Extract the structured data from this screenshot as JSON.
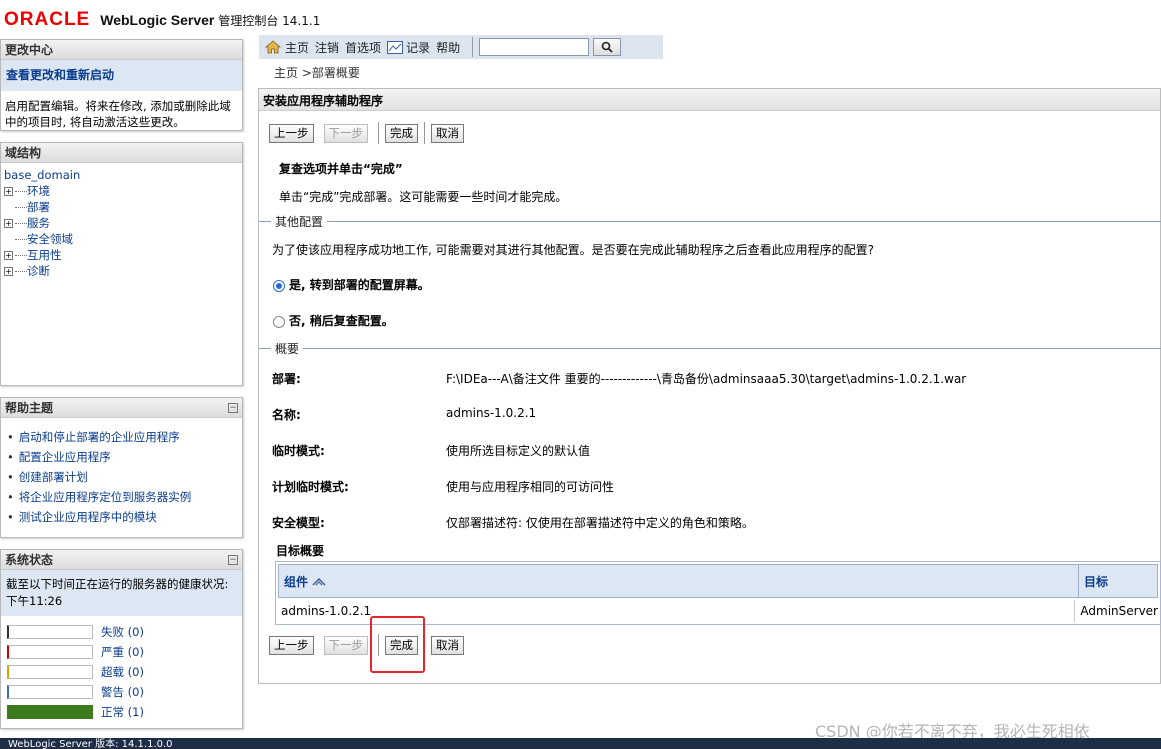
{
  "header": {
    "brand": "ORACLE",
    "product": "WebLogic Server",
    "subtitle": "管理控制台 14.1.1"
  },
  "change_center": {
    "title": "更改中心",
    "link": "查看更改和重新启动",
    "text": "启用配置编辑。将来在修改, 添加或删除此域中的项目时, 将自动激活这些更改。"
  },
  "domain_structure": {
    "title": "域结构",
    "root": "base_domain",
    "nodes": [
      {
        "label": "环境",
        "expandable": true
      },
      {
        "label": "部署",
        "expandable": false
      },
      {
        "label": "服务",
        "expandable": true
      },
      {
        "label": "安全领域",
        "expandable": false
      },
      {
        "label": "互用性",
        "expandable": true
      },
      {
        "label": "诊断",
        "expandable": true
      }
    ]
  },
  "help": {
    "title": "帮助主题",
    "items": [
      "启动和停止部署的企业应用程序",
      "配置企业应用程序",
      "创建部署计划",
      "将企业应用程序定位到服务器实例",
      "测试企业应用程序中的模块"
    ]
  },
  "system_status": {
    "title": "系统状态",
    "text": "截至以下时间正在运行的服务器的健康状况: 下午11:26",
    "rows": [
      {
        "label": "失败 (0)",
        "color": "#cc0000",
        "fill": 0
      },
      {
        "label": "严重 (0)",
        "color": "#cc0000",
        "fill": 0
      },
      {
        "label": "超载 (0)",
        "color": "#e0a000",
        "fill": 0
      },
      {
        "label": "警告 (0)",
        "color": "#3a70c0",
        "fill": 0
      },
      {
        "label": "正常 (1)",
        "color": "#3d7a1d",
        "fill": 1
      }
    ]
  },
  "toolbar": {
    "home": "主页",
    "logout": "注销",
    "prefs": "首选项",
    "record": "记录",
    "help": "帮助"
  },
  "breadcrumb": "主页 >部署概要",
  "main": {
    "title": "安装应用程序辅助程序",
    "buttons": {
      "back": "上一步",
      "next": "下一步",
      "finish": "完成",
      "cancel": "取消"
    },
    "review_title": "复查选项并单击“完成”",
    "review_text": "单击“完成”完成部署。这可能需要一些时间才能完成。",
    "other_config_legend": "其他配置",
    "other_config_question": "为了使该应用程序成功地工作, 可能需要对其进行其他配置。是否要在完成此辅助程序之后查看此应用程序的配置?",
    "radio_yes": "是, 转到部署的配置屏幕。",
    "radio_no": "否, 稍后复查配置。",
    "summary_legend": "概要",
    "summary": [
      {
        "label": "部署:",
        "value": "F:\\IDEa---A\\备注文件 重要的-------------\\青岛备份\\adminsaaa5.30\\target\\admins-1.0.2.1.war"
      },
      {
        "label": "名称:",
        "value": "admins-1.0.2.1"
      },
      {
        "label": "临时模式:",
        "value": "使用所选目标定义的默认值"
      },
      {
        "label": "计划临时模式:",
        "value": "使用与应用程序相同的可访问性"
      },
      {
        "label": "安全模型:",
        "value": "仅部署描述符: 仅使用在部署描述符中定义的角色和策略。"
      }
    ],
    "target_summary": "目标概要",
    "table": {
      "col_component": "组件",
      "col_target": "目标",
      "rows": [
        {
          "component": "admins-1.0.2.1",
          "target": "AdminServer"
        }
      ]
    }
  },
  "footer": "WebLogic Server 版本: 14.1.1.0.0",
  "watermark": "CSDN @你若不离不弃，我必生死相依"
}
